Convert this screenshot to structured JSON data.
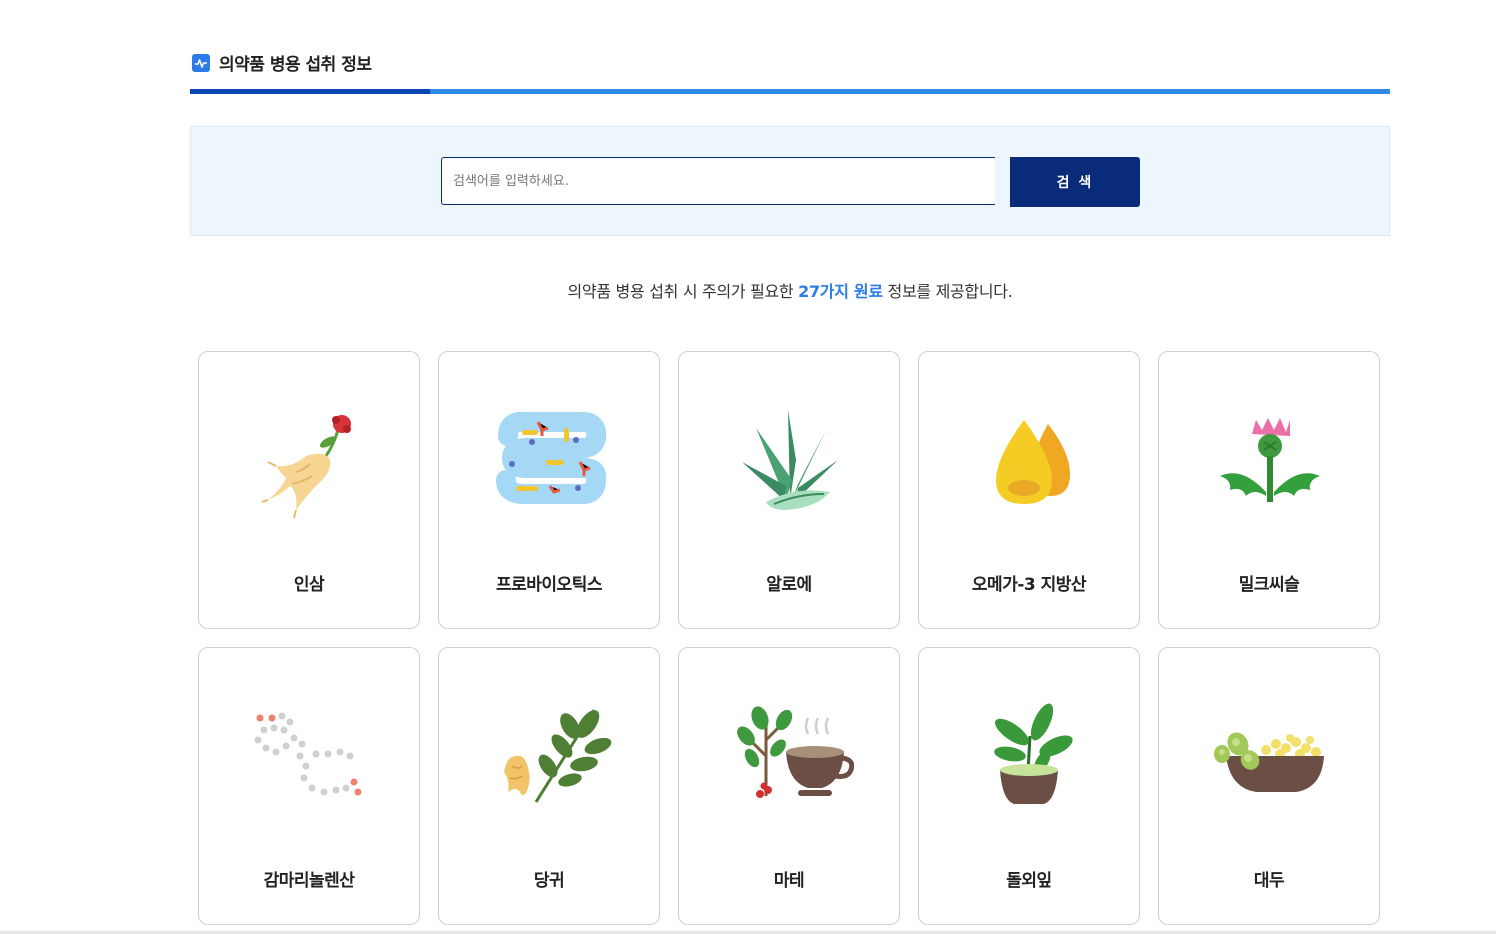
{
  "header": {
    "title": "의약품 병용 섭취 정보",
    "icon": "pulse-chart-icon",
    "accent": "#2b7ce9"
  },
  "search": {
    "placeholder": "검색어를 입력하세요.",
    "value": "",
    "button_label": "검 색"
  },
  "notice": {
    "before": "의약품 병용 섭취 시 주의가 필요한 ",
    "highlight": "27가지 원료",
    "after": " 정보를 제공합니다."
  },
  "items": [
    {
      "label": "인삼",
      "icon": "ginseng-icon"
    },
    {
      "label": "프로바이오틱스",
      "icon": "probiotics-icon"
    },
    {
      "label": "알로에",
      "icon": "aloe-icon"
    },
    {
      "label": "오메가-3 지방산",
      "icon": "oil-drop-icon"
    },
    {
      "label": "밀크씨슬",
      "icon": "milk-thistle-icon"
    },
    {
      "label": "감마리놀렌산",
      "icon": "molecule-chain-icon"
    },
    {
      "label": "당귀",
      "icon": "angelica-root-icon"
    },
    {
      "label": "마테",
      "icon": "mate-tea-icon"
    },
    {
      "label": "돌외잎",
      "icon": "potted-leaf-icon"
    },
    {
      "label": "대두",
      "icon": "soybean-bowl-icon"
    }
  ]
}
